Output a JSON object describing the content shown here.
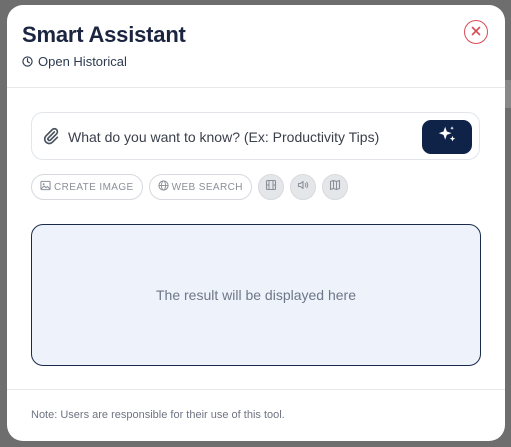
{
  "modal": {
    "title": "Smart Assistant",
    "history_label": "Open Historical"
  },
  "search": {
    "placeholder": "What do you want to know? (Ex: Productivity Tips)",
    "value": ""
  },
  "tools": {
    "create_image_label": "CREATE IMAGE",
    "web_search_label": "WEB SEARCH",
    "icons": [
      "video-icon",
      "audio-icon",
      "map-icon"
    ]
  },
  "result": {
    "placeholder_text": "The result will be displayed here"
  },
  "footer": {
    "note": "Note: Users are responsible for their use of this tool."
  },
  "colors": {
    "primary": "#0f2248",
    "close": "#d84a55",
    "result_bg": "#eef2fa"
  }
}
